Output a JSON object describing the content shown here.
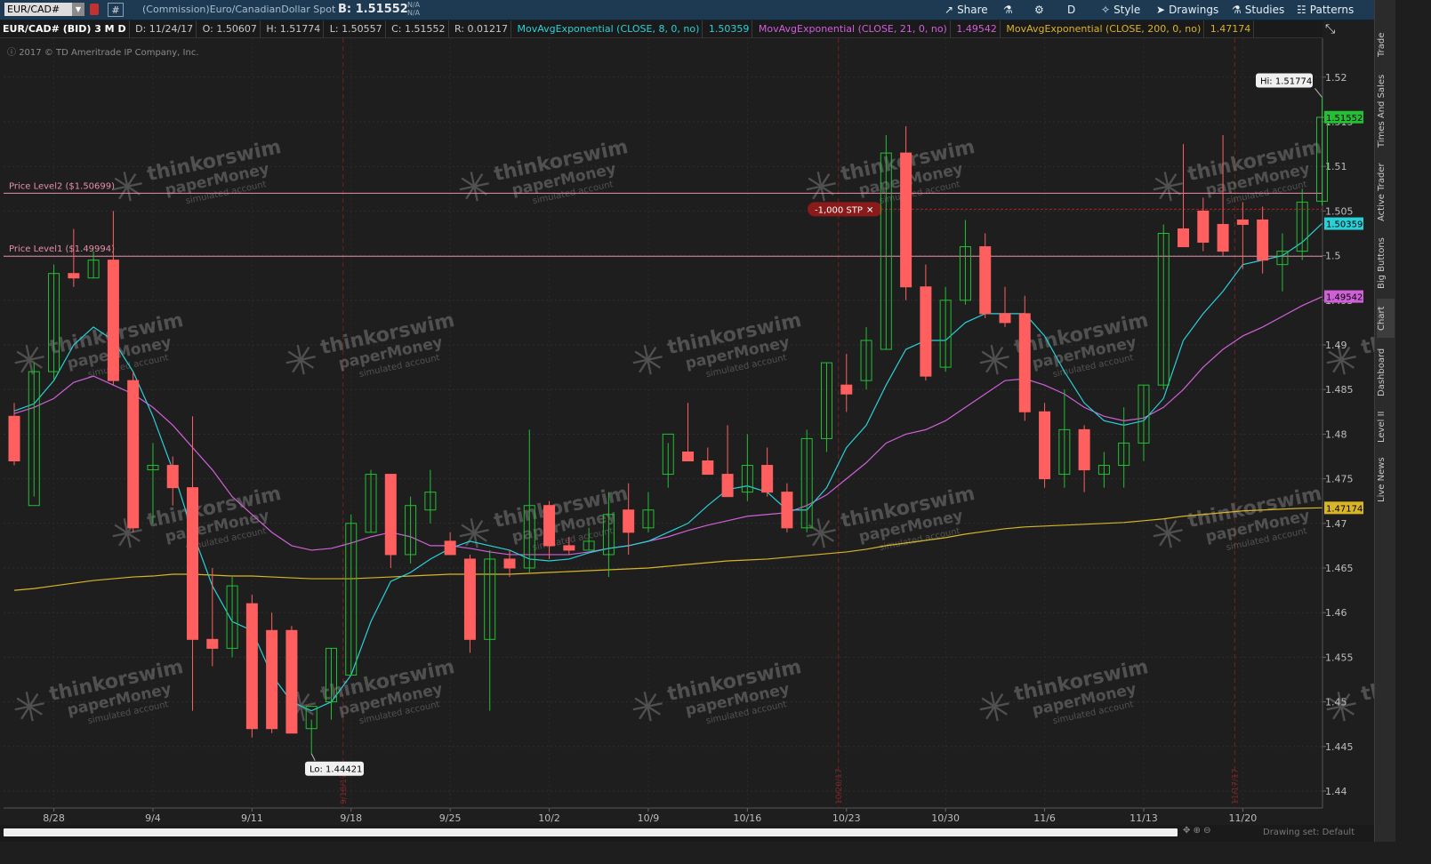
{
  "toolbar": {
    "symbol": "EUR/CAD#",
    "hash": "#",
    "description": "(Commission)Euro/CanadianDollar Spot",
    "bid": "B: 1.51552",
    "na1": "N/A",
    "na2": "N/A",
    "buttons": [
      {
        "label": "Share",
        "icon": "share-icon",
        "glyph": "↗"
      },
      {
        "label": "",
        "icon": "flask-icon",
        "glyph": "⚗"
      },
      {
        "label": "",
        "icon": "gear-icon",
        "glyph": "⚙"
      },
      {
        "label": "D",
        "icon": "",
        "glyph": ""
      },
      {
        "label": "Style",
        "icon": "style-icon",
        "glyph": "✧"
      },
      {
        "label": "Drawings",
        "icon": "cursor-icon",
        "glyph": "➤"
      },
      {
        "label": "Studies",
        "icon": "flask-studies-icon",
        "glyph": "⚗"
      },
      {
        "label": "Patterns",
        "icon": "patterns-icon",
        "glyph": "☷"
      }
    ]
  },
  "infobar": {
    "symbol": "EUR/CAD# (BID) 3 M D",
    "date": "D: 11/24/17",
    "open": "O: 1.50607",
    "high": "H: 1.51774",
    "low": "L: 1.50557",
    "close": "C: 1.51552",
    "range": "R: 0.01217",
    "ma8_label": "MovAvgExponential (CLOSE, 8, 0, no)",
    "ma8_value": "1.50359",
    "ma21_label": "MovAvgExponential (CLOSE, 21, 0, no)",
    "ma21_value": "1.49542",
    "ma200_label": "MovAvgExponential (CLOSE, 200, 0, no)",
    "ma200_value": "1.47174"
  },
  "copyright": "2017 © TD Ameritrade IP Company, Inc.",
  "side_tabs": [
    "Trade",
    "Times And Sales",
    "Active Trader",
    "Big Buttons",
    "Chart",
    "Dashboard",
    "Level II",
    "Live News"
  ],
  "active_tab": "Chart",
  "bottom": {
    "drawing_set": "Drawing set: Default"
  },
  "colors": {
    "up": "#22c032",
    "down": "#ff5f5f",
    "ma8": "#2ad0d8",
    "ma21": "#d060d8",
    "ma200": "#d8b428",
    "price_level": "#e88fa8",
    "background": "#1e1e1e",
    "hi_lo_label": "#f0f0f0",
    "stop_order": "#8b1a1a"
  },
  "watermark": {
    "line1": "thinkorswim",
    "line2": "paperMoney",
    "line3": "simulated account"
  },
  "chart_data": {
    "type": "candlestick",
    "y_ticks": [
      1.44,
      1.445,
      1.45,
      1.455,
      1.46,
      1.465,
      1.47,
      1.475,
      1.48,
      1.485,
      1.49,
      1.495,
      1.5,
      1.505,
      1.51,
      1.515,
      1.52
    ],
    "y_tick_labels": [
      "1.44",
      "1.445",
      "1.45",
      "1.455",
      "1.46",
      "1.465",
      "1.47",
      "1.475",
      "1.48",
      "1.485",
      "1.49",
      "1.495",
      "1.5",
      "1.505",
      "1.51",
      "1.515",
      "1.52"
    ],
    "ylim": [
      1.438,
      1.5225
    ],
    "x_labels": [
      "8/28",
      "9/4",
      "9/11",
      "9/18",
      "9/25",
      "10/2",
      "10/9",
      "10/16",
      "10/23",
      "10/30",
      "11/6",
      "11/13",
      "11/20"
    ],
    "x_label_index": [
      2,
      7,
      12,
      17,
      22,
      27,
      32,
      37,
      42,
      47,
      52,
      57,
      62
    ],
    "month_markers": [
      {
        "index": 17,
        "label": "9/18/17"
      },
      {
        "index": 42,
        "label": "10/20/17"
      },
      {
        "index": 62,
        "label": "11/17/17"
      }
    ],
    "candles": [
      [
        1.482,
        1.4835,
        1.4765,
        1.477
      ],
      [
        1.472,
        1.488,
        1.473,
        1.487
      ],
      [
        1.487,
        1.499,
        1.486,
        1.498
      ],
      [
        1.498,
        1.503,
        1.4965,
        1.4975
      ],
      [
        1.4975,
        1.5005,
        1.4975,
        1.4995
      ],
      [
        1.4995,
        1.505,
        1.4855,
        1.486
      ],
      [
        1.486,
        1.487,
        1.469,
        1.4695
      ],
      [
        1.476,
        1.479,
        1.47,
        1.4765
      ],
      [
        1.4765,
        1.4775,
        1.472,
        1.474
      ],
      [
        1.474,
        1.482,
        1.449,
        1.457
      ],
      [
        1.457,
        1.465,
        1.454,
        1.456
      ],
      [
        1.456,
        1.464,
        1.455,
        1.463
      ],
      [
        1.461,
        1.462,
        1.446,
        1.447
      ],
      [
        1.458,
        1.46,
        1.4465,
        1.447
      ],
      [
        1.458,
        1.4585,
        1.4465,
        1.4465
      ],
      [
        1.447,
        1.448,
        1.4442,
        1.4495
      ],
      [
        1.45,
        1.456,
        1.448,
        1.456
      ],
      [
        1.453,
        1.471,
        1.453,
        1.47
      ],
      [
        1.469,
        1.476,
        1.469,
        1.4755
      ],
      [
        1.4755,
        1.4755,
        1.465,
        1.4665
      ],
      [
        1.4665,
        1.473,
        1.4655,
        1.472
      ],
      [
        1.4715,
        1.476,
        1.47,
        1.4735
      ],
      [
        1.468,
        1.469,
        1.4665,
        1.4665
      ],
      [
        1.466,
        1.4665,
        1.4555,
        1.457
      ],
      [
        1.457,
        1.467,
        1.449,
        1.466
      ],
      [
        1.466,
        1.467,
        1.464,
        1.465
      ],
      [
        1.465,
        1.4805,
        1.4645,
        1.472
      ],
      [
        1.472,
        1.4725,
        1.466,
        1.4675
      ],
      [
        1.4675,
        1.4685,
        1.4665,
        1.467
      ],
      [
        1.467,
        1.4695,
        1.467,
        1.468
      ],
      [
        1.4665,
        1.4735,
        1.464,
        1.471
      ],
      [
        1.4715,
        1.4745,
        1.4665,
        1.469
      ],
      [
        1.4695,
        1.4735,
        1.469,
        1.4715
      ],
      [
        1.4755,
        1.479,
        1.474,
        1.48
      ],
      [
        1.478,
        1.4835,
        1.477,
        1.477
      ],
      [
        1.477,
        1.4785,
        1.4755,
        1.4755
      ],
      [
        1.4755,
        1.481,
        1.4735,
        1.473
      ],
      [
        1.4735,
        1.48,
        1.4725,
        1.4765
      ],
      [
        1.4765,
        1.4785,
        1.473,
        1.4735
      ],
      [
        1.4735,
        1.4745,
        1.469,
        1.4695
      ],
      [
        1.4695,
        1.4805,
        1.469,
        1.4795
      ],
      [
        1.4795,
        1.488,
        1.478,
        1.488
      ],
      [
        1.4855,
        1.489,
        1.4825,
        1.4845
      ],
      [
        1.486,
        1.492,
        1.485,
        1.4905
      ],
      [
        1.4895,
        1.5135,
        1.4895,
        1.5115
      ],
      [
        1.5115,
        1.5145,
        1.495,
        1.4965
      ],
      [
        1.4965,
        1.499,
        1.486,
        1.4865
      ],
      [
        1.4875,
        1.4965,
        1.487,
        1.495
      ],
      [
        1.495,
        1.504,
        1.4945,
        1.501
      ],
      [
        1.501,
        1.5025,
        1.493,
        1.4935
      ],
      [
        1.4935,
        1.4965,
        1.492,
        1.4925
      ],
      [
        1.4935,
        1.4955,
        1.4815,
        1.4825
      ],
      [
        1.4825,
        1.4835,
        1.474,
        1.475
      ],
      [
        1.4755,
        1.485,
        1.474,
        1.4805
      ],
      [
        1.4805,
        1.481,
        1.4735,
        1.476
      ],
      [
        1.4755,
        1.478,
        1.474,
        1.4765
      ],
      [
        1.4765,
        1.483,
        1.474,
        1.479
      ],
      [
        1.479,
        1.4855,
        1.477,
        1.4855
      ],
      [
        1.4855,
        1.5035,
        1.485,
        1.5025
      ],
      [
        1.503,
        1.5125,
        1.502,
        1.501
      ],
      [
        1.505,
        1.5065,
        1.5005,
        1.5015
      ],
      [
        1.5035,
        1.5135,
        1.5,
        1.5005
      ],
      [
        1.504,
        1.506,
        1.4985,
        1.5035
      ],
      [
        1.504,
        1.5055,
        1.498,
        1.4995
      ],
      [
        1.499,
        1.5025,
        1.496,
        1.5005
      ],
      [
        1.5005,
        1.5075,
        1.4995,
        1.506
      ],
      [
        1.5061,
        1.5177,
        1.5056,
        1.5155
      ]
    ],
    "ma8": [
      1.4826,
      1.4834,
      1.486,
      1.49,
      1.492,
      1.4905,
      1.487,
      1.482,
      1.476,
      1.469,
      1.463,
      1.459,
      1.458,
      1.453,
      1.45,
      1.449,
      1.45,
      1.453,
      1.459,
      1.4635,
      1.4645,
      1.466,
      1.4672,
      1.468,
      1.4675,
      1.467,
      1.466,
      1.4658,
      1.466,
      1.4667,
      1.4672,
      1.4675,
      1.468,
      1.469,
      1.47,
      1.472,
      1.4738,
      1.4742,
      1.4735,
      1.4715,
      1.4715,
      1.474,
      1.4785,
      1.481,
      1.4855,
      1.4895,
      1.4905,
      1.4905,
      1.4925,
      1.4935,
      1.4935,
      1.4935,
      1.491,
      1.487,
      1.4835,
      1.4815,
      1.481,
      1.4815,
      1.484,
      1.4905,
      1.4935,
      1.496,
      1.499,
      1.4995,
      1.5,
      1.5015,
      1.5036
    ],
    "ma21": [
      1.4823,
      1.483,
      1.484,
      1.4858,
      1.4865,
      1.4855,
      1.4845,
      1.483,
      1.481,
      1.4785,
      1.476,
      1.473,
      1.471,
      1.469,
      1.4675,
      1.467,
      1.4672,
      1.4678,
      1.4685,
      1.469,
      1.4685,
      1.4675,
      1.4675,
      1.4672,
      1.4668,
      1.4665,
      1.4665,
      1.4665,
      1.4665,
      1.4668,
      1.4672,
      1.4675,
      1.468,
      1.4685,
      1.4692,
      1.4698,
      1.4703,
      1.4708,
      1.471,
      1.4712,
      1.472,
      1.4732,
      1.475,
      1.4768,
      1.479,
      1.48,
      1.4805,
      1.4815,
      1.483,
      1.4845,
      1.486,
      1.4862,
      1.4855,
      1.4845,
      1.483,
      1.482,
      1.4815,
      1.4818,
      1.483,
      1.485,
      1.4875,
      1.4895,
      1.491,
      1.492,
      1.4932,
      1.4944,
      1.4954
    ],
    "ma200": [
      1.4625,
      1.4627,
      1.463,
      1.4633,
      1.4636,
      1.4638,
      1.464,
      1.4641,
      1.4643,
      1.4643,
      1.4642,
      1.4641,
      1.4641,
      1.464,
      1.4639,
      1.4638,
      1.4638,
      1.4638,
      1.4639,
      1.464,
      1.4641,
      1.4642,
      1.4643,
      1.4643,
      1.4643,
      1.4643,
      1.4644,
      1.4645,
      1.4646,
      1.4647,
      1.4648,
      1.4649,
      1.465,
      1.4652,
      1.4654,
      1.4656,
      1.4658,
      1.4659,
      1.466,
      1.4662,
      1.4664,
      1.4666,
      1.4668,
      1.4671,
      1.4675,
      1.4678,
      1.4681,
      1.4684,
      1.4688,
      1.4691,
      1.4694,
      1.4696,
      1.4697,
      1.4698,
      1.4699,
      1.47,
      1.4701,
      1.4703,
      1.4705,
      1.4708,
      1.471,
      1.4712,
      1.4714,
      1.4715,
      1.4716,
      1.4717,
      1.47174
    ],
    "price_levels": [
      {
        "label": "Price Level2 ($1.50699)",
        "value": 1.50699
      },
      {
        "label": "Price Level1 ($1.49994)",
        "value": 1.49994
      }
    ],
    "stop_order": {
      "label": "-1,000 STP",
      "close_glyph": "✕",
      "value": 1.5052
    },
    "hi_label": "Hi: 1.51774",
    "hi_value": 1.51774,
    "lo_label": "Lo: 1.44421",
    "lo_value": 1.44421,
    "price_tags": [
      {
        "text": "1.51552",
        "value": 1.51552,
        "color": "#22c032"
      },
      {
        "text": "1.50359",
        "value": 1.50359,
        "color": "#2ad0d8"
      },
      {
        "text": "1.49542",
        "value": 1.49542,
        "color": "#d060d8"
      },
      {
        "text": "1.47174",
        "value": 1.47174,
        "color": "#d8b428"
      }
    ]
  }
}
